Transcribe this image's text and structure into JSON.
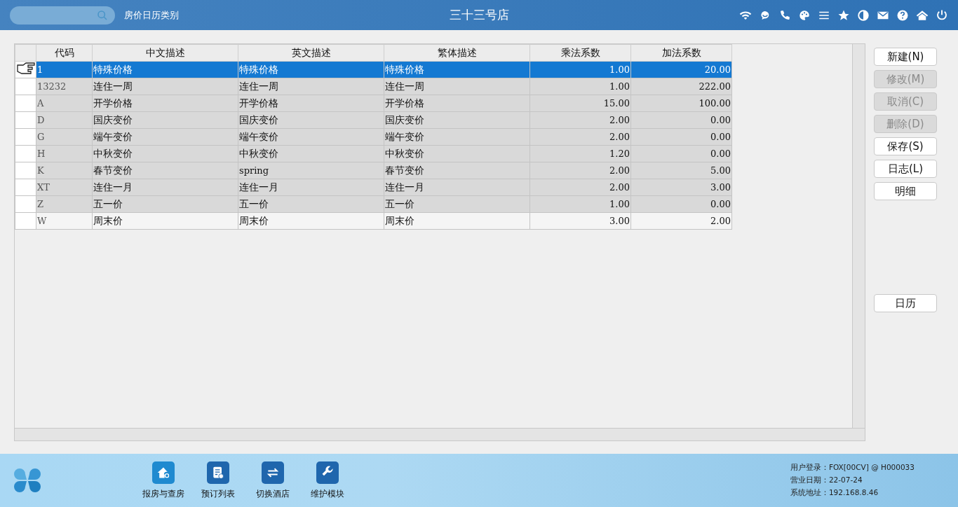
{
  "header": {
    "page_title": "房价日历类别",
    "store_name": "三十三号店"
  },
  "table": {
    "columns": [
      "代码",
      "中文描述",
      "英文描述",
      "繁体描述",
      "乘法系数",
      "加法系数"
    ],
    "rows": [
      {
        "cells": [
          "1",
          "特殊价格",
          "特殊价格",
          "特殊价格",
          "1.00",
          "20.00"
        ],
        "selected": true,
        "shaded": true
      },
      {
        "cells": [
          "13232",
          "连住一周",
          "连住一周",
          "连住一周",
          "1.00",
          "222.00"
        ],
        "selected": false,
        "shaded": true
      },
      {
        "cells": [
          "A",
          "开学价格",
          "开学价格",
          "开学价格",
          "15.00",
          "100.00"
        ],
        "selected": false,
        "shaded": true
      },
      {
        "cells": [
          "D",
          "国庆变价",
          "国庆变价",
          "国庆变价",
          "2.00",
          "0.00"
        ],
        "selected": false,
        "shaded": true
      },
      {
        "cells": [
          "G",
          "端午变价",
          "端午变价",
          "端午变价",
          "2.00",
          "0.00"
        ],
        "selected": false,
        "shaded": true
      },
      {
        "cells": [
          "H",
          "中秋变价",
          "中秋变价",
          "中秋变价",
          "1.20",
          "0.00"
        ],
        "selected": false,
        "shaded": true
      },
      {
        "cells": [
          "K",
          "春节变价",
          "spring",
          "春节变价",
          "2.00",
          "5.00"
        ],
        "selected": false,
        "shaded": true
      },
      {
        "cells": [
          "XT",
          "连住一月",
          "连住一月",
          "连住一月",
          "2.00",
          "3.00"
        ],
        "selected": false,
        "shaded": true
      },
      {
        "cells": [
          "Z",
          "五一价",
          "五一价",
          "五一价",
          "1.00",
          "0.00"
        ],
        "selected": false,
        "shaded": true
      },
      {
        "cells": [
          "W",
          "周末价",
          "周末价",
          "周末价",
          "3.00",
          "2.00"
        ],
        "selected": false,
        "shaded": false
      }
    ]
  },
  "actions": [
    {
      "label": "新建(N)",
      "disabled": false
    },
    {
      "label": "修改(M)",
      "disabled": true
    },
    {
      "label": "取消(C)",
      "disabled": true
    },
    {
      "label": "删除(D)",
      "disabled": true
    },
    {
      "label": "保存(S)",
      "disabled": false
    },
    {
      "label": "日志(L)",
      "disabled": false
    },
    {
      "label": "明细",
      "disabled": false
    }
  ],
  "calendar_button": {
    "label": "日历",
    "disabled": false
  },
  "modules": [
    {
      "label": "报房与查房",
      "kind": "house"
    },
    {
      "label": "预订列表",
      "kind": "list"
    },
    {
      "label": "切换酒店",
      "kind": "switch"
    },
    {
      "label": "维护模块",
      "kind": "wrench"
    }
  ],
  "status": [
    {
      "label": "用户登录：",
      "value": "FOX[00CV] @ H000033"
    },
    {
      "label": "营业日期：",
      "value": "22-07-24"
    },
    {
      "label": "系统地址：",
      "value": "192.168.8.46"
    }
  ]
}
